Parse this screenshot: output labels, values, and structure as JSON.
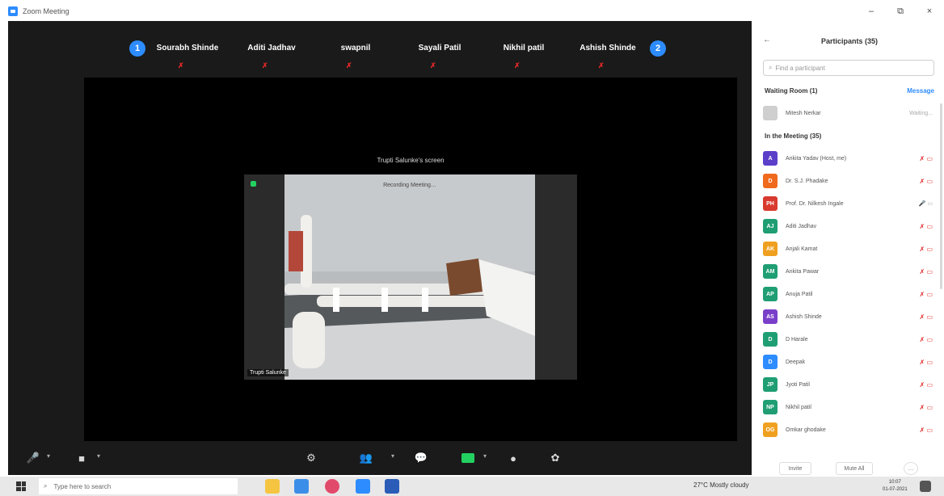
{
  "window": {
    "title": "Zoom Meeting",
    "controls": [
      "–",
      "⧉",
      "×"
    ]
  },
  "strip": {
    "prev_label": "1",
    "next_label": "2",
    "participants": [
      {
        "name": "Sourabh Shinde"
      },
      {
        "name": "Aditi Jadhav"
      },
      {
        "name": "swapnil"
      },
      {
        "name": "Sayali Patil"
      },
      {
        "name": "Nikhil patil"
      },
      {
        "name": "Ashish Shinde"
      }
    ]
  },
  "stage": {
    "caption": "Trupti Salunke's screen",
    "share_label": "Recording Meeting…",
    "share_owner": "Trupti Salunke"
  },
  "panel": {
    "title": "Participants (35)",
    "search_placeholder": "Find a participant",
    "waiting_header": "Waiting Room (1)",
    "message_label": "Message",
    "waiting": [
      {
        "name": "Mitesh Nerkar",
        "initials": "",
        "status": "Waiting..."
      }
    ],
    "in_meeting_header": "In the Meeting (35)",
    "members": [
      {
        "initials": "A",
        "name": "Ankita Yadav (Host, me)",
        "color": "#5b3fc9"
      },
      {
        "initials": "D",
        "name": "Dr. S.J. Phadake",
        "color": "#ef6a1d"
      },
      {
        "initials": "PH",
        "name": "Prof. Dr. Nilkesh Ingale",
        "color": "#d93a2f"
      },
      {
        "initials": "AJ",
        "name": "Aditi Jadhav",
        "color": "#1f9e74"
      },
      {
        "initials": "AK",
        "name": "Anjali Kamat",
        "color": "#f0a020"
      },
      {
        "initials": "AM",
        "name": "Ankita Pawar",
        "color": "#1f9e74"
      },
      {
        "initials": "AP",
        "name": "Anuja Patil",
        "color": "#1f9e74"
      },
      {
        "initials": "AS",
        "name": "Ashish Shinde",
        "color": "#7a3fc9"
      },
      {
        "initials": "D",
        "name": "D Harale",
        "color": "#1f9e74"
      },
      {
        "initials": "D",
        "name": "Deepak",
        "color": "#2d8cff"
      },
      {
        "initials": "JP",
        "name": "Jyoti Patil",
        "color": "#1f9e74"
      },
      {
        "initials": "NP",
        "name": "Nikhil patil",
        "color": "#1f9e74"
      },
      {
        "initials": "OG",
        "name": "Omkar ghodake",
        "color": "#f0a020"
      }
    ],
    "invite_label": "Invite",
    "mute_all_label": "Mute All",
    "more_label": "…"
  },
  "taskbar": {
    "search_placeholder": "Type here to search",
    "weather": "27°C  Mostly cloudy",
    "time": "10:07",
    "date": "01-07-2021"
  },
  "colors": {
    "accent": "#2d8cff",
    "muted_red": "#e02828",
    "meeting_bg": "#1a1a1a"
  },
  "icons": [
    "mic-muted-icon",
    "video-off-icon",
    "security-icon",
    "participants-icon",
    "chat-icon",
    "share-screen-icon",
    "record-icon",
    "reactions-icon"
  ]
}
